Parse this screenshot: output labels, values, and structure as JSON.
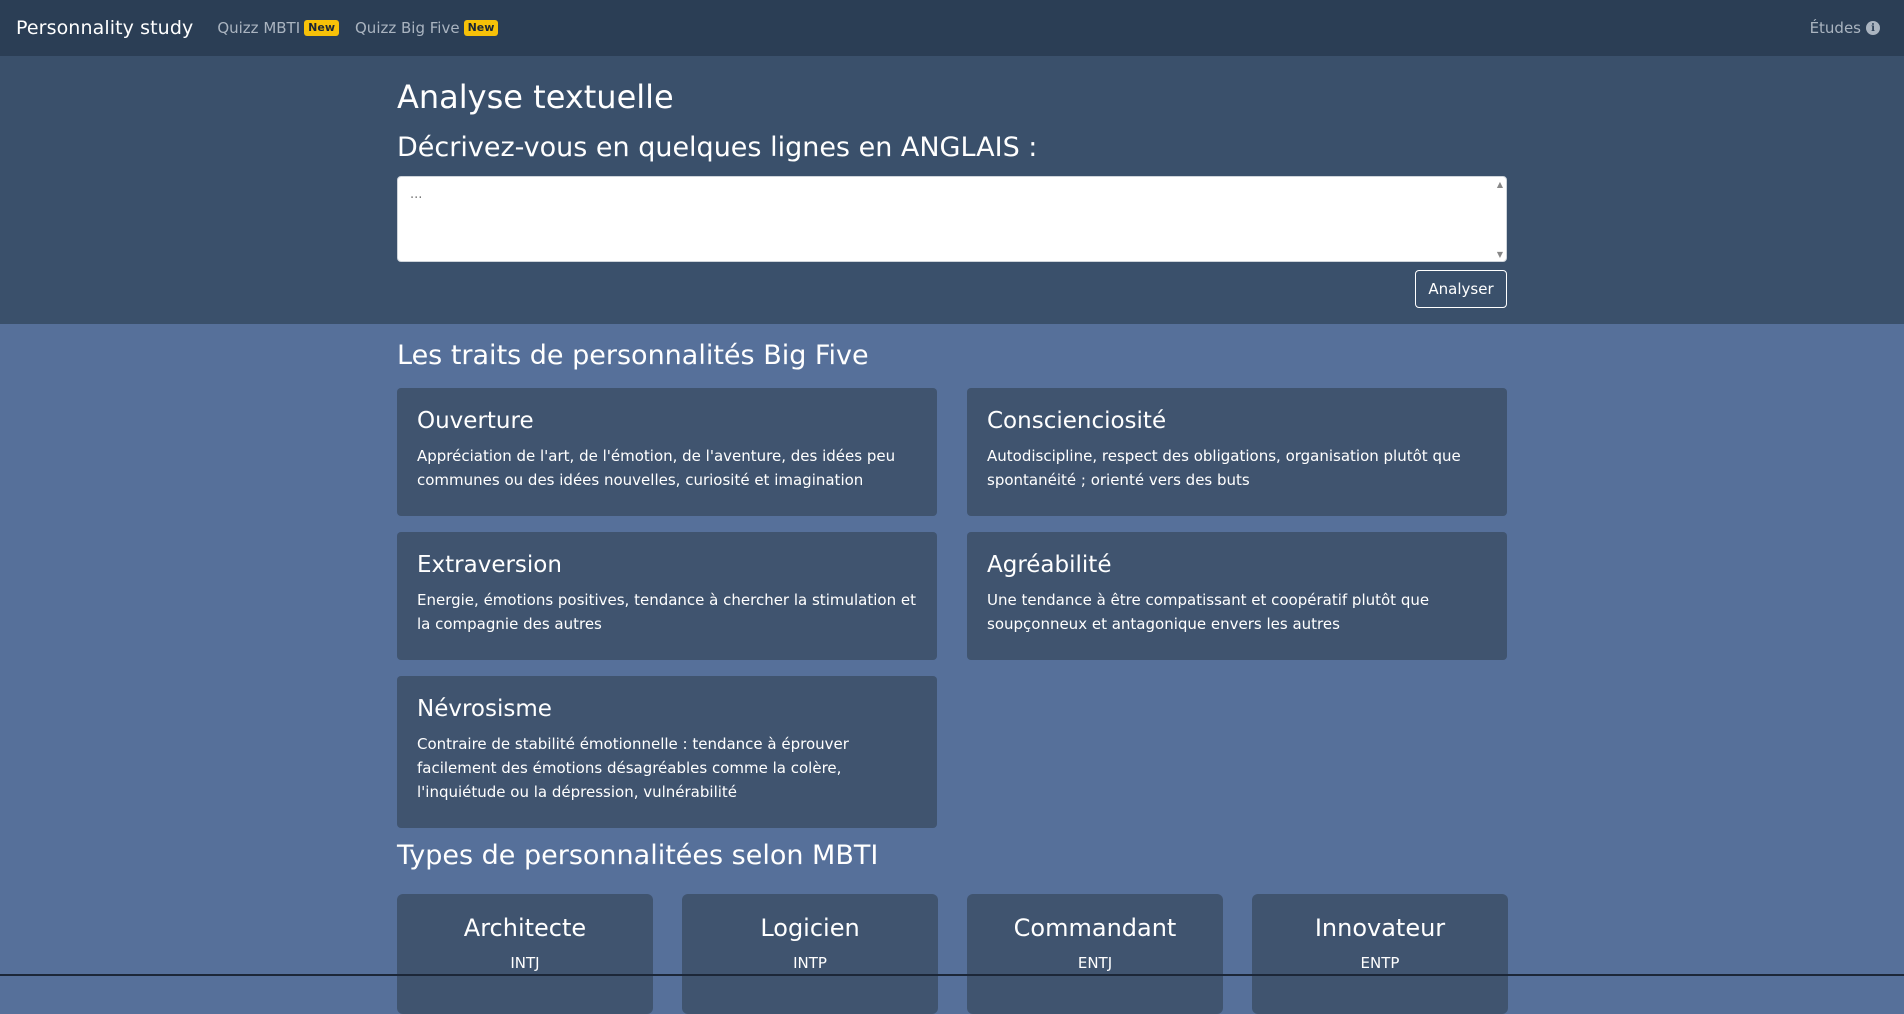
{
  "navbar": {
    "brand": "Personnality study",
    "links": [
      {
        "label": "Quizz MBTI",
        "badge": "New"
      },
      {
        "label": "Quizz Big Five",
        "badge": "New"
      }
    ],
    "right_label": "Études",
    "right_icon": "info-icon",
    "right_icon_glyph": "i"
  },
  "hero": {
    "title": "Analyse textuelle",
    "subtitle": "Décrivez-vous en quelques lignes en ANGLAIS :",
    "textarea_placeholder": "...",
    "button_label": "Analyser"
  },
  "bigfive": {
    "title": "Les traits de personnalités Big Five",
    "cards": [
      {
        "name": "Ouverture",
        "desc": "Appréciation de l'art, de l'émotion, de l'aventure, des idées peu communes ou des idées nouvelles, curiosité et imagination"
      },
      {
        "name": "Conscienciosité",
        "desc": "Autodiscipline, respect des obligations, organisation plutôt que spontanéité ; orienté vers des buts"
      },
      {
        "name": "Extraversion",
        "desc": "Energie, émotions positives, tendance à chercher la stimulation et la compagnie des autres"
      },
      {
        "name": "Agréabilité",
        "desc": "Une tendance à être compatissant et coopératif plutôt que soupçonneux et antagonique envers les autres"
      },
      {
        "name": "Névrosisme",
        "desc": "Contraire de stabilité émotionnelle : tendance à éprouver facilement des émotions désagréables comme la colère, l'inquiétude ou la dépression, vulnérabilité"
      }
    ]
  },
  "mbti": {
    "title": "Types de personnalitées selon MBTI",
    "cards": [
      {
        "name": "Architecte",
        "code": "INTJ"
      },
      {
        "name": "Logicien",
        "code": "INTP"
      },
      {
        "name": "Commandant",
        "code": "ENTJ"
      },
      {
        "name": "Innovateur",
        "code": "ENTP"
      }
    ]
  },
  "colors": {
    "navbar": "#2b3e55",
    "hero": "#3a506b",
    "page": "#56709a",
    "card": "#40546f",
    "badge": "#f7c108"
  }
}
